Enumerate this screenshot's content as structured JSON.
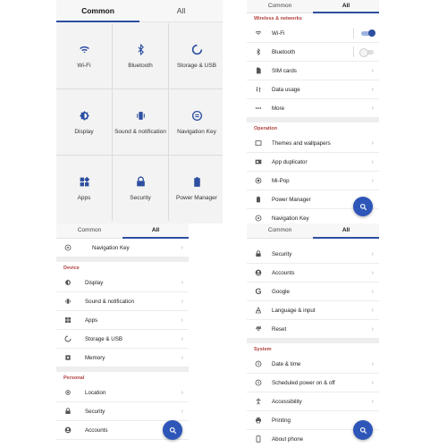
{
  "tabs": {
    "common": "Common",
    "all": "All"
  },
  "grid": {
    "items": [
      {
        "label": "Wi-Fi",
        "icon": "wifi-icon"
      },
      {
        "label": "Bluetooth",
        "icon": "bluetooth-icon"
      },
      {
        "label": "Storage & USB",
        "icon": "storage-icon"
      },
      {
        "label": "Display",
        "icon": "display-icon"
      },
      {
        "label": "Sound & notification",
        "icon": "sound-icon"
      },
      {
        "label": "Navigation Key",
        "icon": "navigation-key-icon"
      },
      {
        "label": "Apps",
        "icon": "apps-icon"
      },
      {
        "label": "Security",
        "icon": "lock-icon"
      },
      {
        "label": "Power Manager",
        "icon": "battery-icon"
      }
    ]
  },
  "panel2": {
    "wireless_header": "Wireless & networks",
    "wireless": [
      {
        "label": "Wi-Fi",
        "control": "toggle-on"
      },
      {
        "label": "Bluetooth",
        "control": "toggle-off"
      },
      {
        "label": "SIM cards"
      },
      {
        "label": "Data usage"
      },
      {
        "label": "More"
      }
    ],
    "operation_header": "Operation",
    "operation": [
      {
        "label": "Themes and wallpapers"
      },
      {
        "label": "App duplicator"
      },
      {
        "label": "Mi-Pop"
      },
      {
        "label": "Power Manager"
      },
      {
        "label": "Navigation Key"
      }
    ]
  },
  "panel3": {
    "top_row": "Navigation Key",
    "device_header": "Device",
    "device": [
      {
        "label": "Display"
      },
      {
        "label": "Sound & notification"
      },
      {
        "label": "Apps"
      },
      {
        "label": "Storage & USB"
      },
      {
        "label": "Memory"
      }
    ],
    "personal_header": "Personal",
    "personal": [
      {
        "label": "Location"
      },
      {
        "label": "Security"
      },
      {
        "label": "Accounts"
      }
    ]
  },
  "panel4": {
    "rows": [
      {
        "label": "Security"
      },
      {
        "label": "Accounts"
      },
      {
        "label": "Google"
      },
      {
        "label": "Language & input"
      },
      {
        "label": "Reset"
      }
    ],
    "system_header": "System",
    "system": [
      {
        "label": "Date & time"
      },
      {
        "label": "Scheduled power on & off"
      },
      {
        "label": "Accessibility"
      },
      {
        "label": "Printing"
      },
      {
        "label": "About phone"
      }
    ]
  },
  "colors": {
    "accent": "#2d4fa0",
    "fab": "#2d56b8",
    "section_header": "#b0413e"
  }
}
